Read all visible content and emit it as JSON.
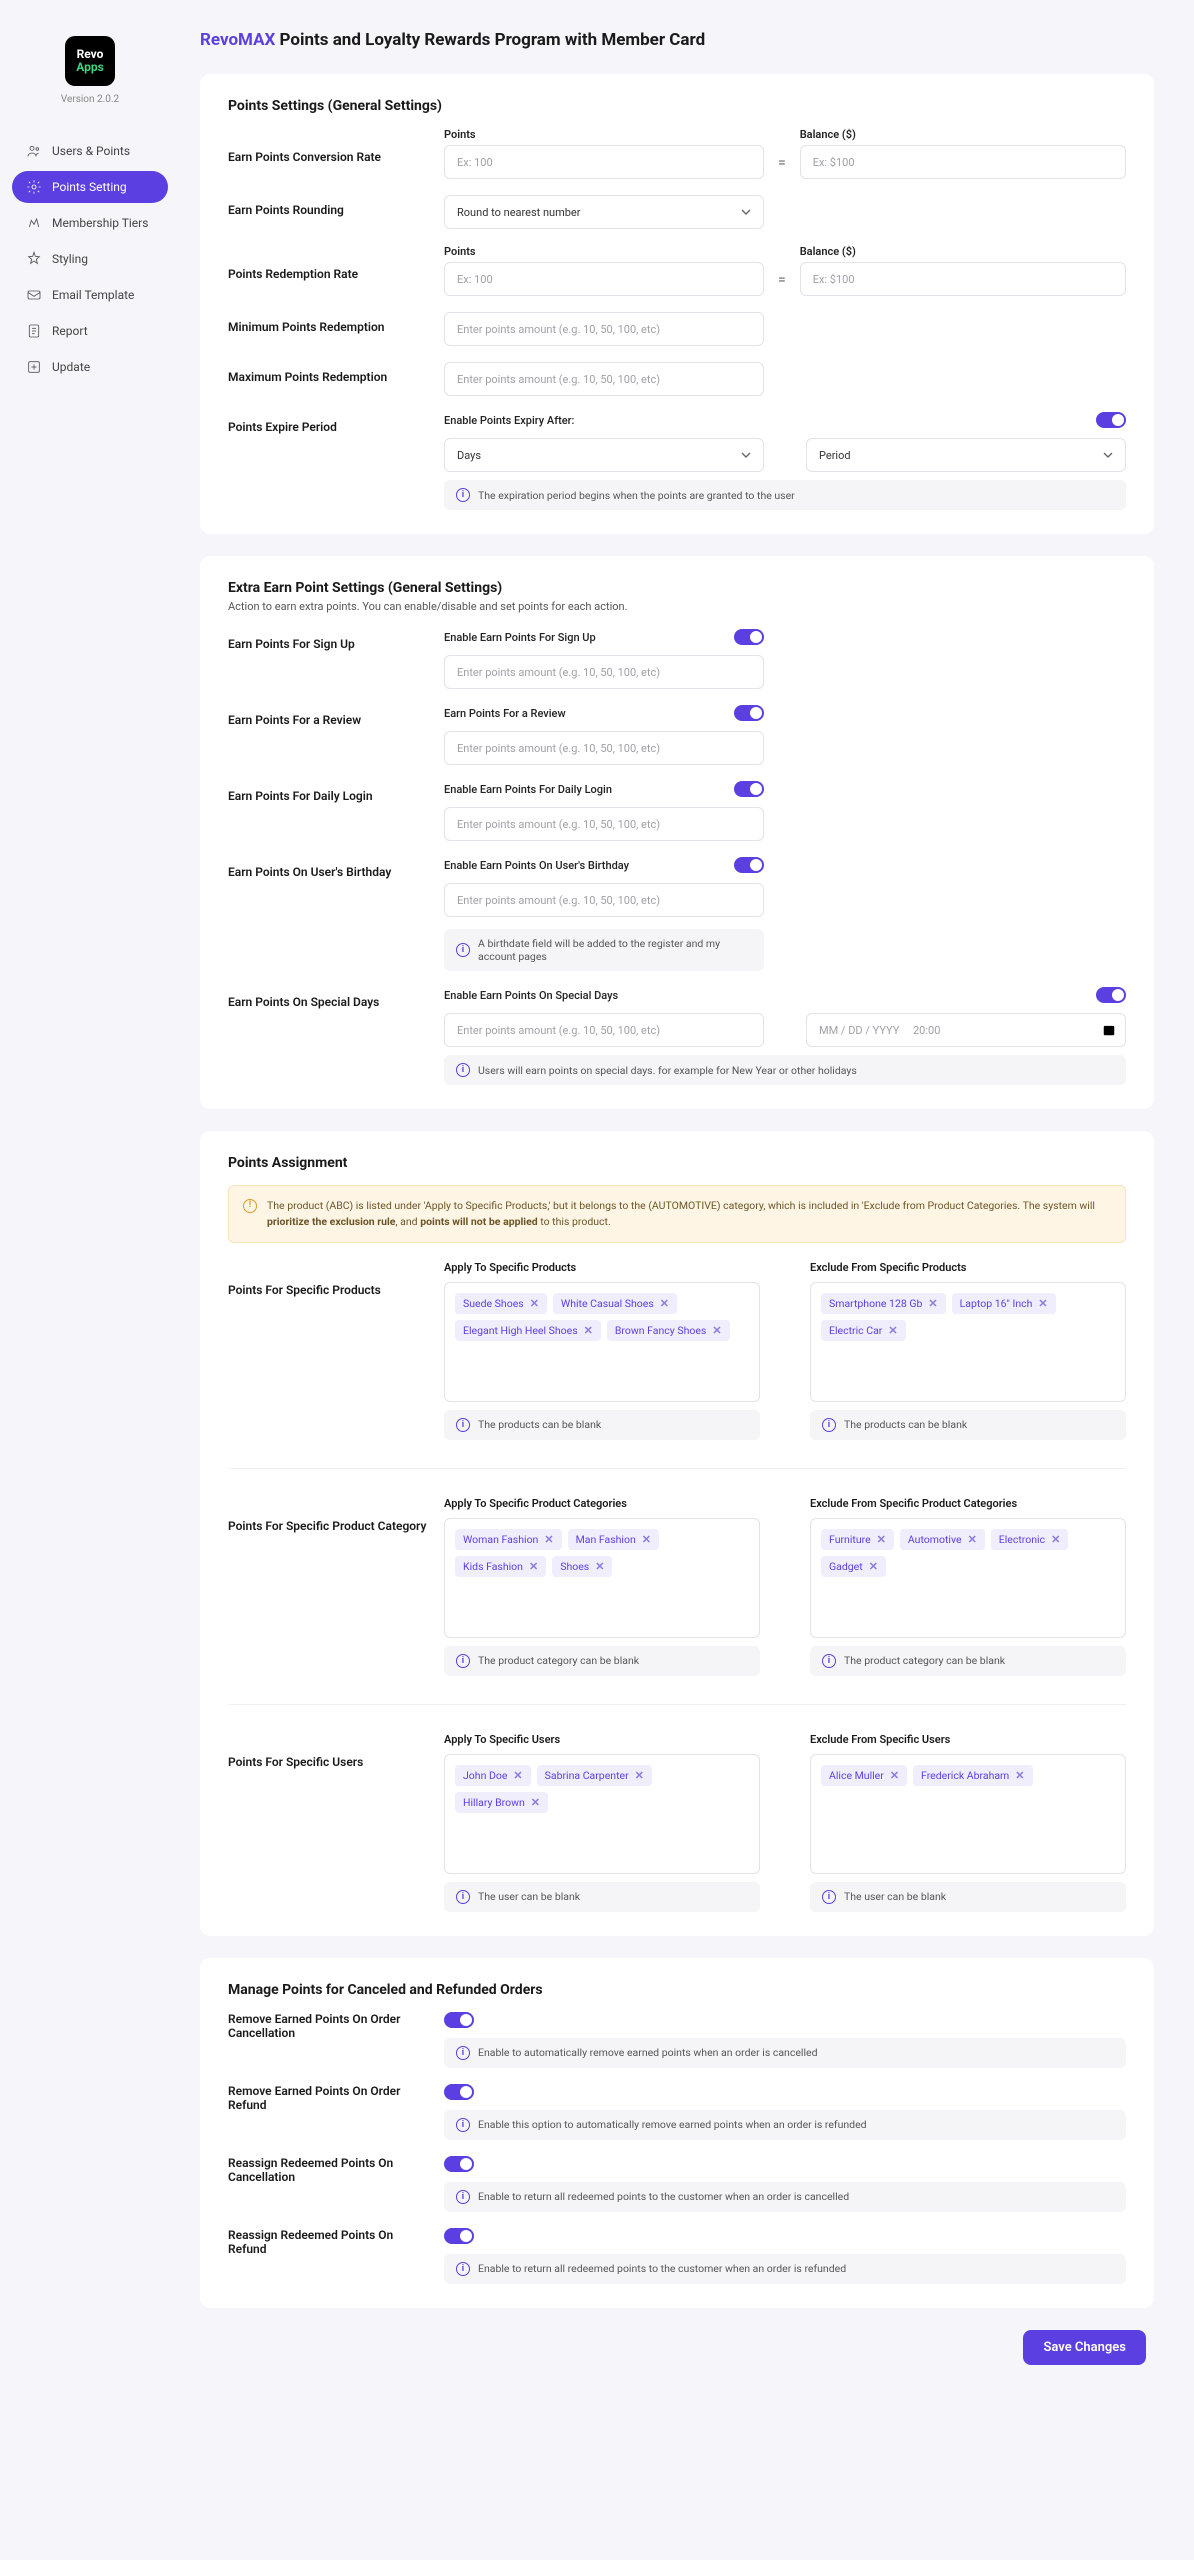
{
  "app": {
    "logo_line1": "Revo",
    "logo_line2": "Apps",
    "version": "Version 2.0.2",
    "title_accent": "RevoMAX",
    "title_rest": " Points and Loyalty Rewards Program with Member Card"
  },
  "nav": [
    {
      "icon": "users",
      "label": "Users & Points"
    },
    {
      "icon": "settings",
      "label": "Points Setting",
      "active": true
    },
    {
      "icon": "tiers",
      "label": "Membership Tiers"
    },
    {
      "icon": "styling",
      "label": "Styling"
    },
    {
      "icon": "email",
      "label": "Email Template"
    },
    {
      "icon": "report",
      "label": "Report"
    },
    {
      "icon": "update",
      "label": "Update"
    }
  ],
  "section1": {
    "title": "Points Settings (General Settings)",
    "rows": {
      "conversion_rate": "Earn Points Conversion Rate",
      "points_label": "Points",
      "points_ph": "Ex: 100",
      "balance_label": "Balance ($)",
      "balance_ph": "Ex: $100",
      "rounding": "Earn Points Rounding",
      "rounding_val": "Round to nearest number",
      "redemption": "Points Redemption Rate",
      "min_redemption": "Minimum Points Redemption",
      "max_redemption": "Maximum Points Redemption",
      "amount_ph": "Enter points amount (e.g. 10, 50, 100, etc)",
      "expire": "Points Expire Period",
      "expire_toggle": "Enable Points Expiry After:",
      "days": "Days",
      "period": "Period",
      "expire_info": "The expiration period begins when the points are granted to the user"
    }
  },
  "section2": {
    "title": "Extra Earn Point Settings (General Settings)",
    "sub": "Action to earn extra points. You can enable/disable and set points for each action.",
    "amount_ph": "Enter points amount (e.g. 10, 50, 100, etc)",
    "signup": {
      "label": "Earn Points For Sign Up",
      "toggle": "Enable Earn Points For Sign Up"
    },
    "review": {
      "label": "Earn Points For a Review",
      "toggle": "Earn Points For a Review"
    },
    "daily": {
      "label": "Earn Points For Daily Login",
      "toggle": "Enable Earn Points For Daily Login"
    },
    "birthday": {
      "label": "Earn Points On User's Birthday",
      "toggle": "Enable Earn Points On User's Birthday",
      "info": "A birthdate field will be added to the register and my account pages"
    },
    "special": {
      "label": "Earn Points On Special Days",
      "toggle": "Enable Earn Points On Special Days",
      "date_ph": "MM / DD / YYYY     20:00",
      "info": "Users will earn points on special days. for example for New Year or other holidays"
    }
  },
  "section3": {
    "title": "Points Assignment",
    "warning_pre": "The product (ABC) is listed under 'Apply to Specific Products,' but it belongs to the (AUTOMOTIVE) category, which is included in 'Exclude from Product Categories. The system will ",
    "warning_bold1": "prioritize the exclusion rule",
    "warning_mid": ", and ",
    "warning_bold2": "points will not be applied",
    "warning_post": " to this product.",
    "products": {
      "row": "Points For Specific Products",
      "apply_h": "Apply To Specific Products",
      "exclude_h": "Exclude From Specific Products",
      "apply": [
        "Suede Shoes",
        "White Casual Shoes",
        "Elegant High Heel Shoes",
        "Brown Fancy Shoes"
      ],
      "exclude": [
        "Smartphone 128 Gb",
        "Laptop 16\" Inch",
        "Electric Car"
      ],
      "info": "The products can be blank"
    },
    "categories": {
      "row": "Points For Specific Product Category",
      "apply_h": "Apply To Specific Product Categories",
      "exclude_h": "Exclude From Specific  Product Categories",
      "apply": [
        "Woman Fashion",
        "Man Fashion",
        "Kids Fashion",
        "Shoes"
      ],
      "exclude": [
        "Furniture",
        "Automotive",
        "Electronic",
        "Gadget"
      ],
      "info": "The product category can be blank"
    },
    "users": {
      "row": "Points For Specific Users",
      "apply_h": "Apply To Specific Users",
      "exclude_h": "Exclude From Specific Users",
      "apply": [
        "John Doe",
        "Sabrina Carpenter",
        "Hillary Brown"
      ],
      "exclude": [
        "Alice Muller",
        "Frederick Abraham"
      ],
      "info": "The user can be blank"
    }
  },
  "section4": {
    "title": "Manage Points for Canceled and Refunded Orders",
    "rows": [
      {
        "label": "Remove Earned Points On Order Cancellation",
        "info": "Enable to automatically remove earned points when an order is cancelled",
        "on": true
      },
      {
        "label": "Remove Earned Points On Order Refund",
        "info": "Enable this option to automatically remove earned points when an order is refunded",
        "on": true
      },
      {
        "label": "Reassign Redeemed Points On Cancellation",
        "info": "Enable to return all redeemed points to the customer when an order is cancelled",
        "on": true
      },
      {
        "label": "Reassign Redeemed Points On Refund",
        "info": "Enable to return all redeemed points to the customer when an order is refunded",
        "on": true
      }
    ]
  },
  "save": "Save Changes"
}
